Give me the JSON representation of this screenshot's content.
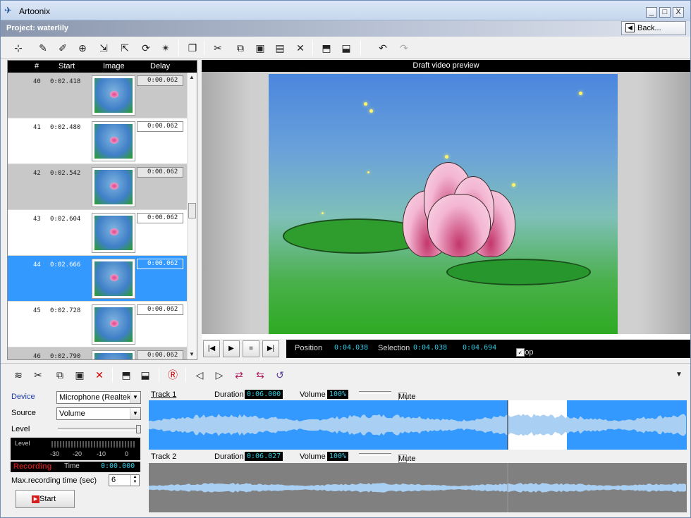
{
  "window": {
    "title": "Artoonix",
    "min": "_",
    "max": "□",
    "close": "X"
  },
  "project": {
    "title": "Project: waterlily",
    "back_label": "Back..."
  },
  "frames": {
    "columns": [
      "#",
      "Start",
      "Image",
      "Delay"
    ],
    "rows": [
      {
        "num": "40",
        "start": "0:02.418",
        "delay": "0:00.062",
        "state": "gray"
      },
      {
        "num": "41",
        "start": "0:02.480",
        "delay": "0:00.062",
        "state": "white"
      },
      {
        "num": "42",
        "start": "0:02.542",
        "delay": "0:00.062",
        "state": "gray"
      },
      {
        "num": "43",
        "start": "0:02.604",
        "delay": "0:00.062",
        "state": "white"
      },
      {
        "num": "44",
        "start": "0:02.666",
        "delay": "0:00.062",
        "state": "selected"
      },
      {
        "num": "45",
        "start": "0:02.728",
        "delay": "0:00.062",
        "state": "white"
      },
      {
        "num": "46",
        "start": "0:02.790",
        "delay": "0:00.062",
        "state": "gray"
      }
    ]
  },
  "preview": {
    "header": "Draft video preview",
    "position_label": "Position",
    "position_value": "0:04.038",
    "selection_label": "Selection",
    "selection_start": "0:04.038",
    "selection_end": "0:04.694",
    "loop_label": "Loop"
  },
  "recorder": {
    "device_label": "Device",
    "device_value": "Microphone (Realtek H",
    "source_label": "Source",
    "source_value": "Volume",
    "level_label": "Level",
    "meter_label": "Level",
    "meter_ticks": [
      "-30",
      "-20",
      "-10",
      "0"
    ],
    "recording_label": "Recording",
    "time_label": "Time",
    "time_value": "0:00.000",
    "max_time_label": "Max.recording time (sec)",
    "max_time_value": "6",
    "start_label": "Start"
  },
  "tracks": [
    {
      "name": "Track 1",
      "duration_label": "Duration",
      "duration": "0:06.000",
      "volume_label": "Volume",
      "volume": "100%",
      "mute_label": "Mute"
    },
    {
      "name": "Track 2",
      "duration_label": "Duration",
      "duration": "0:06.027",
      "volume_label": "Volume",
      "volume": "100%",
      "mute_label": "Mute"
    }
  ],
  "colors": {
    "selection": "#3399ff",
    "track_active": "#3399ff",
    "track_inactive": "#808080",
    "lcd": "#31c9e3"
  }
}
